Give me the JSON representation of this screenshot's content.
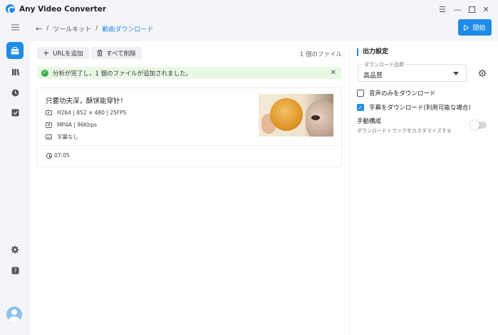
{
  "app": {
    "title": "Any Video Converter"
  },
  "icons": {
    "menu": "menu-icon",
    "minimize": "minimize-icon",
    "maximize": "maximize-icon",
    "close": "close-icon"
  },
  "rail": {
    "items": [
      {
        "icon": "list-icon",
        "active": false
      },
      {
        "icon": "toolbox-icon",
        "active": true
      },
      {
        "icon": "library-icon",
        "active": false
      },
      {
        "icon": "history-icon",
        "active": false
      },
      {
        "icon": "tasks-icon",
        "active": false
      },
      {
        "icon": "settings-icon",
        "active": false
      },
      {
        "icon": "help-icon",
        "active": false
      }
    ]
  },
  "breadcrumb": {
    "sep": "/",
    "items": [
      "ツールキット",
      "動画ダウンロード"
    ]
  },
  "header": {
    "start_label": "開始"
  },
  "toolbar": {
    "add_url_label": "URLを追加",
    "delete_all_label": "すべて削除",
    "file_count": "1 個のファイル"
  },
  "notice": {
    "text": "分析が完了し，1 個のファイルが追加されました。"
  },
  "file": {
    "title": "只要功夫深，酥饼能穿针！",
    "video": "H264 | 852 × 480 | 25FPS",
    "audio": "MP4A | 96Kbps",
    "subtitle": "字幕なし",
    "duration": "07:05"
  },
  "settings": {
    "heading": "出力設定",
    "quality_label": "ダウンロード品質",
    "quality_value": "高品質",
    "audio_only_label": "音声のみをダウンロード",
    "audio_only_checked": false,
    "subtitle_label": "字幕をダウンロード(利用可能な場合)",
    "subtitle_checked": true,
    "manual_title": "手動構成",
    "manual_sub": "ダウンロードトラックをカスタマイズする",
    "manual_enabled": false
  },
  "colors": {
    "accent": "#1f8be8",
    "success": "#3bb54a",
    "notice_bg": "#e9f7e5"
  }
}
